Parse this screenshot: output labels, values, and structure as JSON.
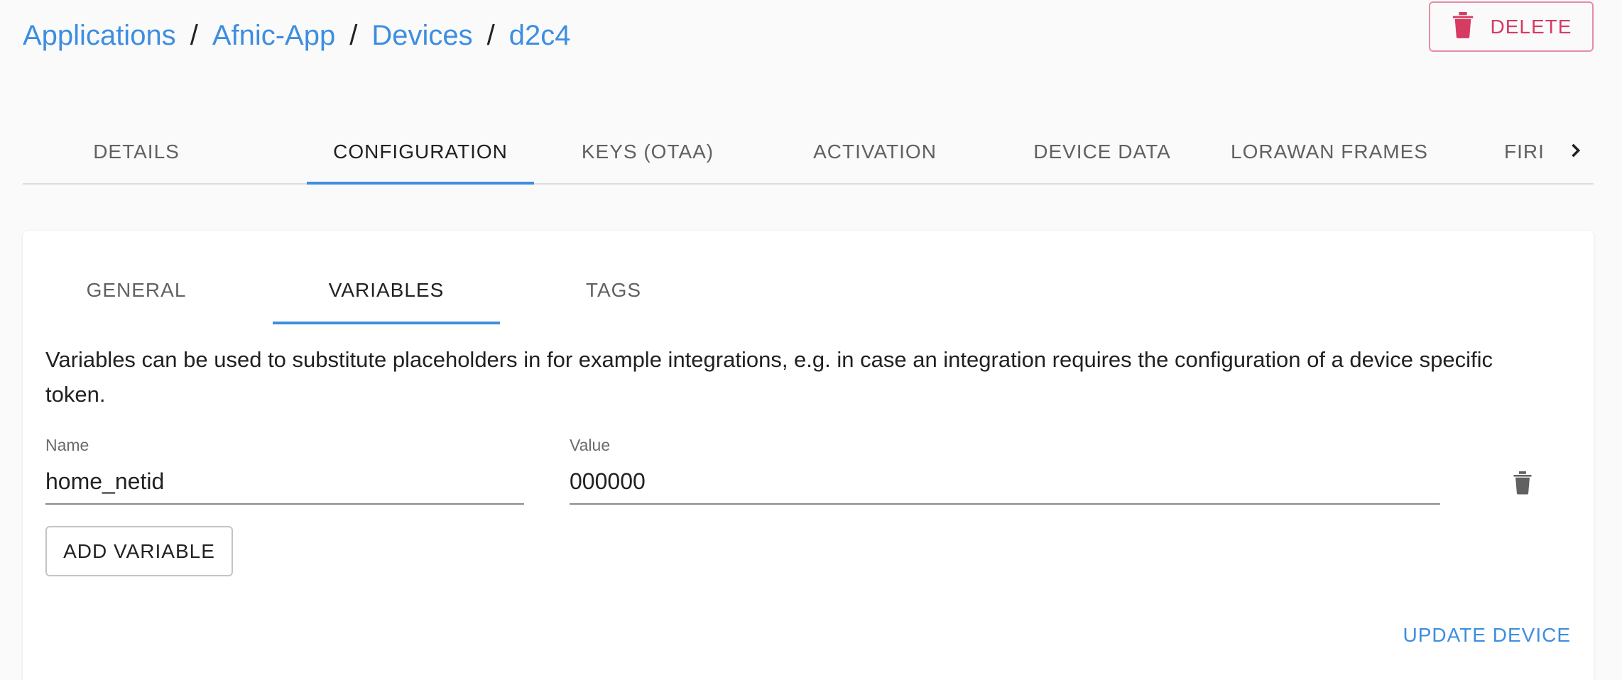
{
  "breadcrumb": {
    "items": [
      "Applications",
      "Afnic-App",
      "Devices",
      "d2c4"
    ],
    "separator": "/"
  },
  "header": {
    "delete_label": "DELETE",
    "delete_icon": "trash-icon"
  },
  "top_tabs": {
    "items": [
      "DETAILS",
      "CONFIGURATION",
      "KEYS (OTAA)",
      "ACTIVATION",
      "DEVICE DATA",
      "LORAWAN FRAMES",
      "FIRI"
    ],
    "active": "CONFIGURATION",
    "scroll_icon": "chevron-right-icon"
  },
  "sub_tabs": {
    "items": [
      "GENERAL",
      "VARIABLES",
      "TAGS"
    ],
    "active": "VARIABLES"
  },
  "variables": {
    "description": "Variables can be used to substitute placeholders in for example integrations, e.g. in case an integration requires the configuration of a device specific token.",
    "name_label": "Name",
    "value_label": "Value",
    "rows": [
      {
        "name": "home_netid",
        "value": "000000"
      }
    ],
    "row_delete_icon": "trash-icon",
    "add_label": "ADD VARIABLE",
    "submit_label": "UPDATE DEVICE"
  },
  "colors": {
    "accent": "#3d8ee0",
    "danger": "#d63b62",
    "background": "#fafafa"
  }
}
